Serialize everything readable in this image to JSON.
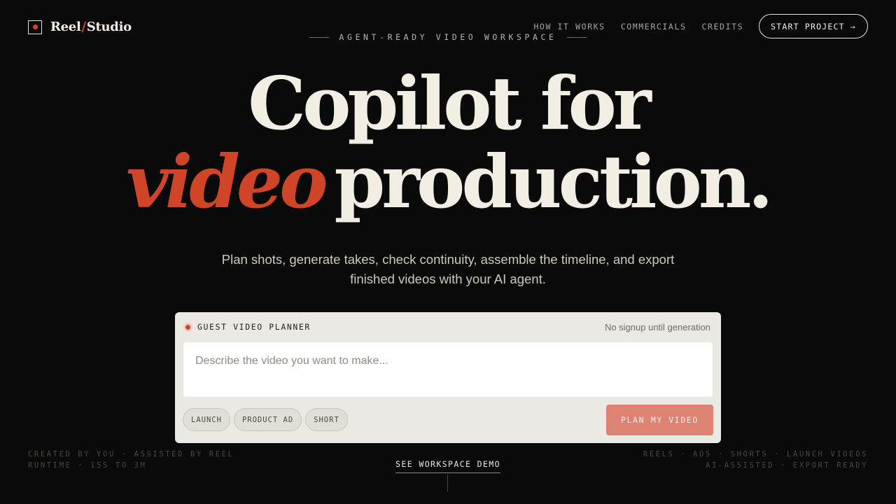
{
  "brand": {
    "name_left": "Reel",
    "slash": "/",
    "name_right": "Studio",
    "accent_color": "#d04428"
  },
  "nav": {
    "links": [
      "HOW IT WORKS",
      "COMMERCIALS",
      "CREDITS"
    ],
    "cta": "START PROJECT →"
  },
  "eyebrow": "AGENT-READY VIDEO WORKSPACE",
  "hero": {
    "line1": "Copilot for",
    "accent": "video",
    "line2_rest": "production."
  },
  "subtitle": {
    "line1": "Plan shots, generate takes, check continuity, assemble the timeline, and export",
    "line2": "finished videos with your AI agent."
  },
  "planner": {
    "title": "GUEST VIDEO PLANNER",
    "note": "No signup until generation",
    "placeholder": "Describe the video you want to make...",
    "value": "",
    "chips": [
      "LAUNCH",
      "PRODUCT AD",
      "SHORT"
    ],
    "submit": "PLAN MY VIDEO"
  },
  "footer": {
    "left_line1": "CREATED BY YOU · ASSISTED BY REEL",
    "left_line2": "RUNTIME · 15S TO 3M",
    "center_link": "SEE WORKSPACE DEMO",
    "right_line1": "REELS · ADS · SHORTS · LAUNCH VIDEOS",
    "right_line2": "AI-ASSISTED · EXPORT READY"
  }
}
